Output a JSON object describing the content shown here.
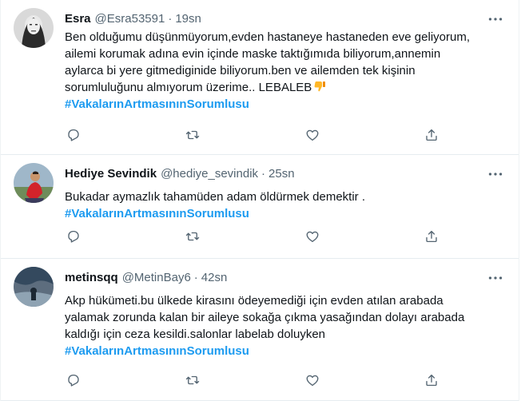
{
  "tweets": [
    {
      "name": "Esra",
      "handle": "@Esra53591",
      "separator": "·",
      "time": "19sn",
      "lines": [
        "Ben olduğumu düşünmüyorum,evden hastaneye hastaneden eve geliyorum,",
        "ailemi korumak adına evin içinde maske taktığımıda biliyorum,annemin",
        "aylarca bi yere gitmediginide biliyorum.ben ve ailemden tek kişinin",
        "sorumluluğunu almıyorum üzerime.. LEBALEB"
      ],
      "emoji": "thumbs-down",
      "hashtag": "#VakalarınArtmasınınSorumlusu"
    },
    {
      "name": "Hediye Sevindik",
      "handle": "@hediye_sevindik",
      "separator": "·",
      "time": "25sn",
      "lines": [
        "Bukadar aymazlık tahamüden adam öldürmek demektir ."
      ],
      "hashtag": "#VakalarınArtmasınınSorumlusu"
    },
    {
      "name": "metinsqq",
      "handle": "@MetinBay6",
      "separator": "·",
      "time": "42sn",
      "lines": [
        "Akp hükümeti.bu ülkede kirasını ödeyemediği için evden atılan arabada",
        "yalamak zorunda kalan bir aileye sokağa çıkma yasağından dolayı arabada",
        "kaldığı için ceza kesildi.salonlar labelab doluyken"
      ],
      "hashtag": "#VakalarınArtmasınınSorumlusu"
    }
  ],
  "icons": {
    "reply": "reply-icon",
    "retweet": "retweet-icon",
    "like": "like-icon",
    "share": "share-icon",
    "more": "more-icon"
  },
  "colors": {
    "hashtag": "#1d9bf0",
    "secondary_text": "#536471",
    "icon": "#536471",
    "divider": "#e6ecf0"
  }
}
